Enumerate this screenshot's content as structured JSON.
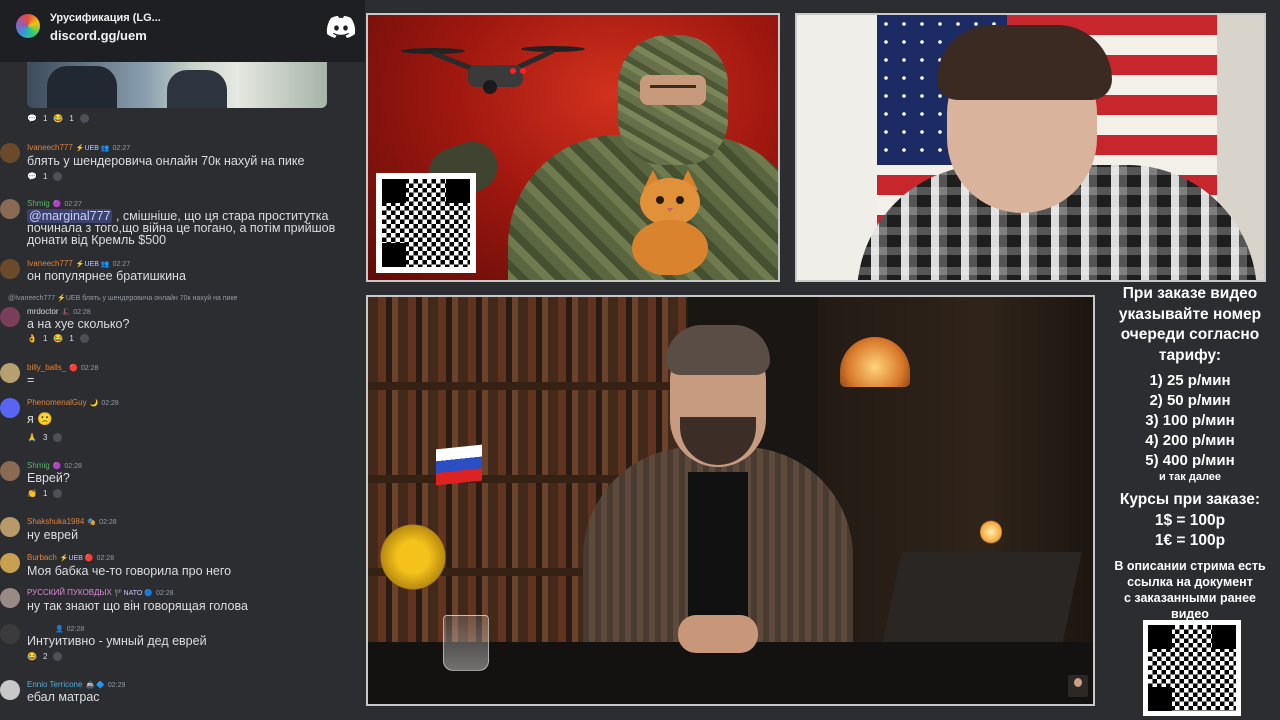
{
  "server": {
    "name": "Урусификация (LG...",
    "invite": "discord.gg/uem",
    "discord_icon": "discord-logo-icon"
  },
  "messages": [
    {
      "id": "m0",
      "reactions": [
        {
          "emoji": "💬",
          "count": "1"
        },
        {
          "emoji": "😂",
          "count": "1"
        }
      ]
    },
    {
      "id": "m1",
      "user": "Ivaneech777",
      "user_color": "#e0823d",
      "badge": "⚡UEB 👥",
      "time": "02:27",
      "text": "блять у шендеровича онлайн 70к нахуй на пике",
      "reactions": [
        {
          "emoji": "💬",
          "count": "1"
        }
      ]
    },
    {
      "id": "m2",
      "user": "Shmig",
      "user_color": "#57b36a",
      "badge": "🟣",
      "time": "02:27",
      "mention": "@marginal777",
      "text": " , смішніше, що ця стара проститутка починала з того,що війна це погано, а потім прийшов донати від Кремль $500"
    },
    {
      "id": "m3",
      "user": "Ivaneech777",
      "user_color": "#e0823d",
      "badge": "⚡UEB 👥",
      "time": "02:27",
      "text": "он популярнее братишкина"
    },
    {
      "id": "m4",
      "reply": "@Ivaneech777 ⚡UEB блять у шендеровича онлайн 70к нахуй на пике",
      "user": "mrdoctor",
      "user_color": "#d8d8d8",
      "badge": "🎩",
      "time": "02:28",
      "text": "а на хуе сколько?",
      "reactions": [
        {
          "emoji": "👌",
          "count": "1"
        },
        {
          "emoji": "😂",
          "count": "1"
        }
      ]
    },
    {
      "id": "m5",
      "user": "billy_balls_",
      "user_color": "#e0823d",
      "badge": "🔴",
      "time": "02:28",
      "text": "="
    },
    {
      "id": "m6",
      "user": "PhenomenalGuy",
      "user_color": "#e0823d",
      "badge": "🌙",
      "time": "02:28",
      "text": "я 🙁",
      "reactions": [
        {
          "emoji": "🙏",
          "count": "3"
        }
      ]
    },
    {
      "id": "m7",
      "user": "Shmig",
      "user_color": "#57b36a",
      "badge": "🟣",
      "time": "02:28",
      "text": "Еврей?",
      "reactions": [
        {
          "emoji": "👏",
          "count": "1"
        }
      ]
    },
    {
      "id": "m8",
      "user": "Shakshuka1984",
      "user_color": "#e0823d",
      "badge": "🎭",
      "time": "02:28",
      "text": "ну еврей"
    },
    {
      "id": "m9",
      "user": "Burbach",
      "user_color": "#e0823d",
      "badge": "⚡UEB 🔴",
      "time": "02:28",
      "text": "Моя бабка че-то говорила про него"
    },
    {
      "id": "m10",
      "user": "РУССКИЙ ПУКОВДЫХ",
      "user_color": "#e08ad8",
      "badge": "🏴NATO 🔵",
      "time": "02:28",
      "text": "ну так знают що він говорящая голова"
    },
    {
      "id": "m11",
      "user": "",
      "user_color": "#e0823d",
      "badge": "👤",
      "time": "02:28",
      "text": "Интуитивно - умный дед еврей",
      "reactions": [
        {
          "emoji": "😂",
          "count": "2"
        }
      ]
    },
    {
      "id": "m12",
      "user": "Ennio Terricone",
      "user_color": "#4fb0e0",
      "badge": "🚢 🔷",
      "time": "02:29",
      "text": "ебал матрас"
    }
  ],
  "info_panel": {
    "heading": [
      "При заказе видео",
      "указывайте номер",
      "очереди согласно",
      "тарифу:"
    ],
    "prices": [
      "1) 25 р/мин",
      "2) 50 р/мин",
      "3) 100 р/мин",
      "4) 200 р/мин",
      "5) 400 р/мин"
    ],
    "prices_more": "и так далее",
    "rates_title": "Курсы при заказе:",
    "rates": [
      "1$ = 100р",
      "1€ = 100р"
    ],
    "description": [
      "В описании стрима есть",
      "ссылка на документ",
      "с заказанными ранее",
      "видео"
    ]
  },
  "colors": {
    "chat_bg": "#2b2d31",
    "server_bar_bg": "#1e1f22",
    "pane_border": "#c8c8c8",
    "mention_bg": "#3c4270"
  }
}
